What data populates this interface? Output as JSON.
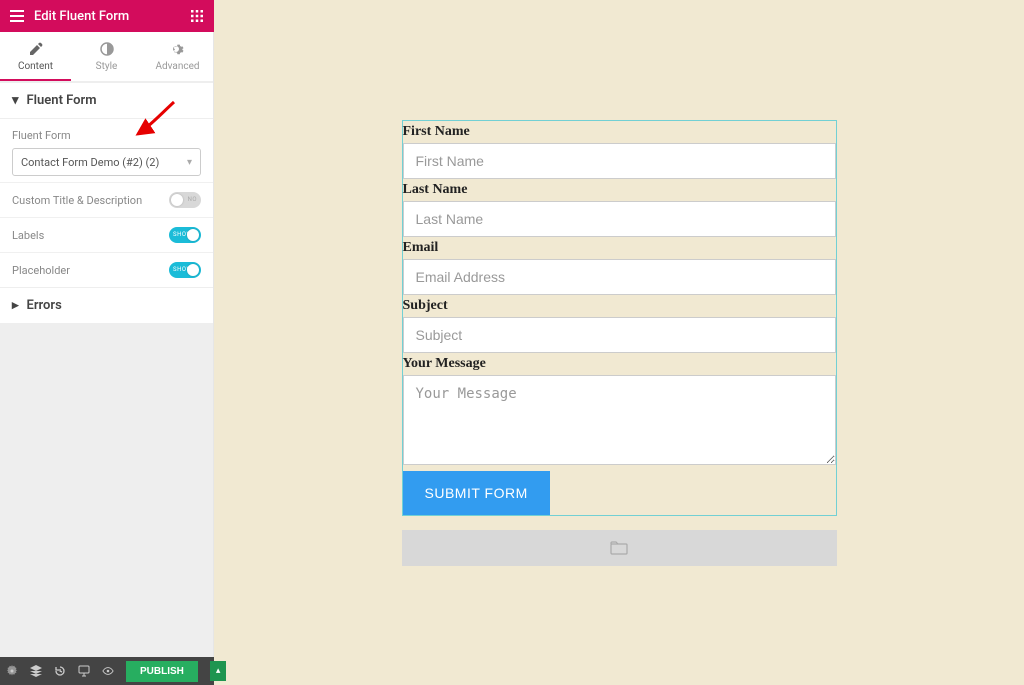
{
  "header": {
    "title": "Edit Fluent Form"
  },
  "tabs": {
    "content": "Content",
    "style": "Style",
    "advanced": "Advanced"
  },
  "section": {
    "title": "Fluent Form",
    "label_form": "Fluent Form",
    "select_value": "Contact Form Demo (#2) (2)",
    "rows": {
      "custom_title": {
        "label": "Custom Title & Description",
        "state": "off",
        "state_label": "NO"
      },
      "labels": {
        "label": "Labels",
        "state": "on",
        "state_label": "SHOW"
      },
      "placeholder": {
        "label": "Placeholder",
        "state": "on",
        "state_label": "SHOW"
      }
    },
    "errors_title": "Errors"
  },
  "form": {
    "fields": {
      "first_name": {
        "label": "First Name",
        "placeholder": "First Name"
      },
      "last_name": {
        "label": "Last Name",
        "placeholder": "Last Name"
      },
      "email": {
        "label": "Email",
        "placeholder": "Email Address"
      },
      "subject": {
        "label": "Subject",
        "placeholder": "Subject"
      },
      "message": {
        "label": "Your Message",
        "placeholder": "Your Message"
      }
    },
    "submit": "SUBMIT FORM"
  },
  "footer": {
    "publish": "PUBLISH"
  }
}
